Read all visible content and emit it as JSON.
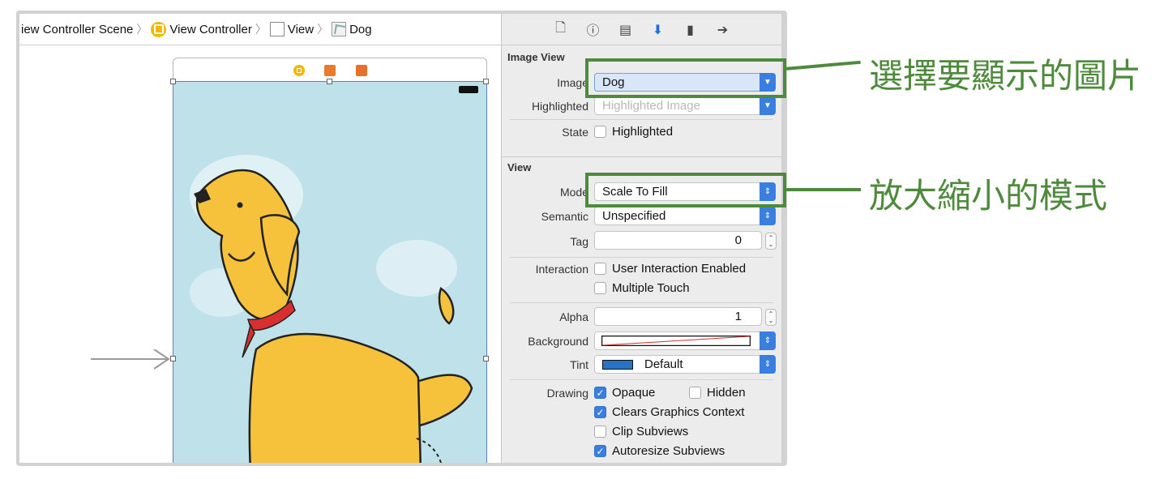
{
  "jumpbar": {
    "items": [
      "iew Controller Scene",
      "View Controller",
      "View",
      "Dog"
    ]
  },
  "inspector": {
    "tab_icons": [
      "file-icon",
      "help-icon",
      "identity-icon",
      "attributes-icon",
      "size-icon",
      "connections-icon"
    ],
    "image_view": {
      "title": "Image View",
      "image_label": "Image",
      "image_value": "Dog",
      "highlighted_label": "Highlighted",
      "highlighted_placeholder": "Highlighted Image",
      "state_label": "State",
      "state_option": "Highlighted"
    },
    "view": {
      "title": "View",
      "mode_label": "Mode",
      "mode_value": "Scale To Fill",
      "semantic_label": "Semantic",
      "semantic_value": "Unspecified",
      "tag_label": "Tag",
      "tag_value": "0",
      "interaction_label": "Interaction",
      "user_interaction": "User Interaction Enabled",
      "multiple_touch": "Multiple Touch",
      "alpha_label": "Alpha",
      "alpha_value": "1",
      "background_label": "Background",
      "tint_label": "Tint",
      "tint_value": "Default",
      "drawing_label": "Drawing",
      "opaque": "Opaque",
      "hidden": "Hidden",
      "clears_graphics": "Clears Graphics Context",
      "clip_subviews": "Clip Subviews",
      "autoresize_subviews": "Autoresize Subviews"
    }
  },
  "annotations": {
    "image_callout": "選擇要顯示的圖片",
    "mode_callout": "放大縮小的模式"
  },
  "colors": {
    "accent": "#3a7fe0",
    "callout": "#4e8a3c",
    "tint_swatch": "#2a72c4",
    "canvas_bg": "#bfe2ea"
  }
}
